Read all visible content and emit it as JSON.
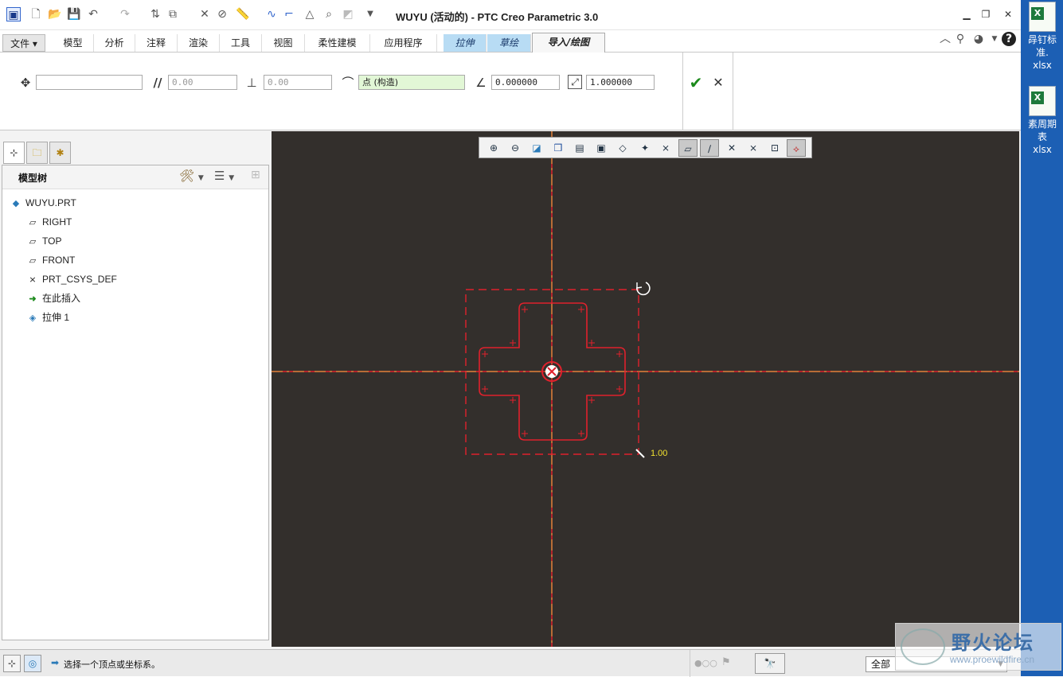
{
  "window": {
    "title": "WUYU (活动的) - PTC Creo Parametric 3.0"
  },
  "tabs": [
    {
      "label": "文件"
    },
    {
      "label": "模型"
    },
    {
      "label": "分析"
    },
    {
      "label": "注释"
    },
    {
      "label": "渲染"
    },
    {
      "label": "工具"
    },
    {
      "label": "视图"
    },
    {
      "label": "柔性建模"
    },
    {
      "label": "应用程序"
    },
    {
      "label": "拉伸"
    },
    {
      "label": "草绘"
    },
    {
      "label": "导入/绘图"
    }
  ],
  "ribbon": {
    "move_value": "",
    "horizontal_value": "0.00",
    "vertical_value": "0.00",
    "ref_point": "点 (构造)",
    "angle_value": "0.000000",
    "scale_value": "1.000000"
  },
  "tree": {
    "header": "模型树",
    "items": [
      {
        "label": "WUYU.PRT",
        "icon": "part-icon"
      },
      {
        "label": "RIGHT",
        "icon": "datum-plane-icon"
      },
      {
        "label": "TOP",
        "icon": "datum-plane-icon"
      },
      {
        "label": "FRONT",
        "icon": "datum-plane-icon"
      },
      {
        "label": "PRT_CSYS_DEF",
        "icon": "csys-icon"
      },
      {
        "label": "在此插入",
        "icon": "insert-arrow-icon"
      },
      {
        "label": "拉伸 1",
        "icon": "extrude-icon"
      }
    ]
  },
  "canvas": {
    "scale_label": "1.00",
    "background": "#332f2c",
    "sketch_color": "#e0212c"
  },
  "status": {
    "message": "选择一个顶点或坐标系。",
    "filter": "全部"
  },
  "desktop": {
    "items": [
      {
        "line1": "冔钉标准.",
        "line2": "xlsx"
      },
      {
        "line1": "素周期表",
        "line2": "xlsx"
      }
    ]
  },
  "watermark": {
    "title": "野火论坛",
    "url": "www.proewildfire.cn"
  }
}
